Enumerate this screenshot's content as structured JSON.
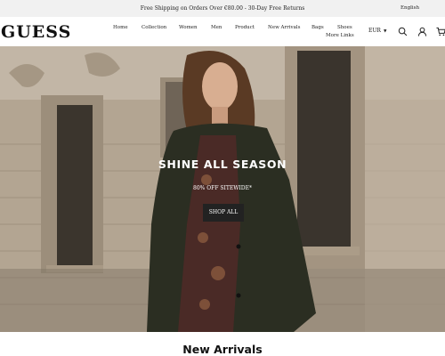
{
  "announcement": {
    "text": "Free Shipping on Orders Over €80.00 - 30-Day Free Returns",
    "language": "English"
  },
  "header": {
    "logo": "GUESS",
    "nav": [
      {
        "label": "Home"
      },
      {
        "label": "Collection"
      },
      {
        "label": "Women"
      },
      {
        "label": "Men"
      },
      {
        "label": "Product"
      },
      {
        "label": "New Arrivals"
      },
      {
        "label": "Bags"
      },
      {
        "label": "Shoes"
      },
      {
        "label": "More Links"
      }
    ],
    "currency": "EUR",
    "icons": [
      "search-icon",
      "account-icon",
      "cart-icon"
    ]
  },
  "hero": {
    "title": "SHINE ALL SEASON",
    "subtitle": "80% OFF SITEWIDE*",
    "button": "SHOP ALL"
  },
  "sections": {
    "new_arrivals_title": "New Arrivals"
  },
  "colors": {
    "announcement_bg": "#f1f1f1",
    "button_bg": "#222222",
    "hero_text": "#ffffff",
    "coat": "#2b2e22"
  }
}
